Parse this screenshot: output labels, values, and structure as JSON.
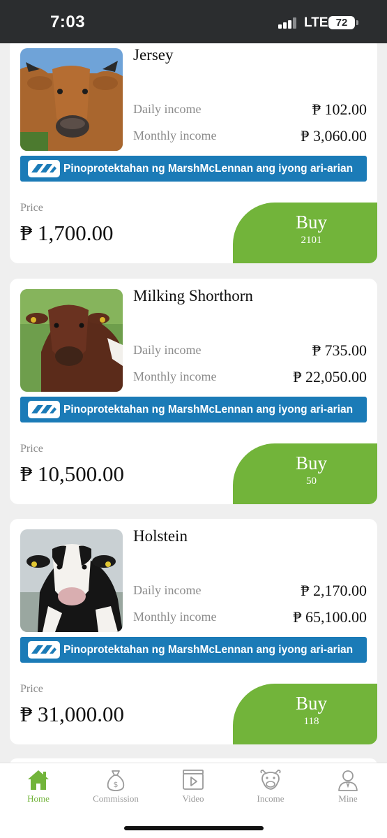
{
  "status_bar": {
    "time": "7:03",
    "network": "LTE",
    "battery": "72"
  },
  "products": [
    {
      "name": "Jersey",
      "image": "jersey-cow-photo",
      "daily_income_label": "Daily income",
      "daily_income": "₱ 102.00",
      "monthly_income_label": "Monthly income",
      "monthly_income": "₱ 3,060.00",
      "insurance_text": "Pinoprotektahan ng MarshMcLennan ang iyong ari-arian",
      "price_label": "Price",
      "price": "₱ 1,700.00",
      "buy_label": "Buy",
      "buy_count": "2101"
    },
    {
      "name": "Milking Shorthorn",
      "image": "milking-shorthorn-cow-photo",
      "daily_income_label": "Daily income",
      "daily_income": "₱ 735.00",
      "monthly_income_label": "Monthly income",
      "monthly_income": "₱ 22,050.00",
      "insurance_text": "Pinoprotektahan ng MarshMcLennan ang iyong ari-arian",
      "price_label": "Price",
      "price": "₱ 10,500.00",
      "buy_label": "Buy",
      "buy_count": "50"
    },
    {
      "name": "Holstein",
      "image": "holstein-cow-photo",
      "daily_income_label": "Daily income",
      "daily_income": "₱ 2,170.00",
      "monthly_income_label": "Monthly income",
      "monthly_income": "₱ 65,100.00",
      "insurance_text": "Pinoprotektahan ng MarshMcLennan ang iyong ari-arian",
      "price_label": "Price",
      "price": "₱ 31,000.00",
      "buy_label": "Buy",
      "buy_count": "118"
    }
  ],
  "tabs": [
    {
      "label": "Home",
      "icon": "home-icon",
      "active": true
    },
    {
      "label": "Commission",
      "icon": "money-bag-icon",
      "active": false
    },
    {
      "label": "Video",
      "icon": "video-icon",
      "active": false
    },
    {
      "label": "Income",
      "icon": "cow-face-icon",
      "active": false
    },
    {
      "label": "Mine",
      "icon": "user-icon",
      "active": false
    }
  ],
  "colors": {
    "accent_green": "#72b43a",
    "banner_blue": "#1b7bb7",
    "status_bar": "#2b2d2f"
  }
}
